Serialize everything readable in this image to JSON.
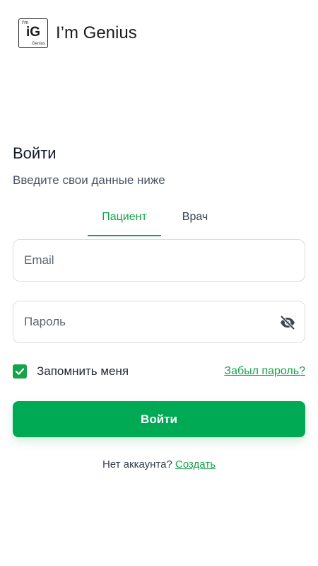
{
  "brand": {
    "logo_sup": "I'm",
    "logo_main": "iG",
    "logo_sub": "Genius",
    "name": "I’m Genius"
  },
  "login": {
    "title": "Войти",
    "subtitle": "Введите свои данные ниже"
  },
  "tabs": [
    {
      "label": "Пациент",
      "active": true
    },
    {
      "label": "Врач",
      "active": false
    }
  ],
  "form": {
    "email_placeholder": "Email",
    "email_value": "",
    "password_placeholder": "Пароль",
    "password_value": "",
    "remember_label": "Запомнить меня",
    "remember_checked": true,
    "forgot_label": "Забыл пароль?",
    "submit_label": "Войти"
  },
  "signup": {
    "prompt": "Нет аккаунта?",
    "link": "Создать"
  },
  "colors": {
    "accent": "#16a34a",
    "button": "#00aa55"
  },
  "icons": {
    "password_toggle": "eye-off-icon",
    "checkbox": "check-icon"
  }
}
